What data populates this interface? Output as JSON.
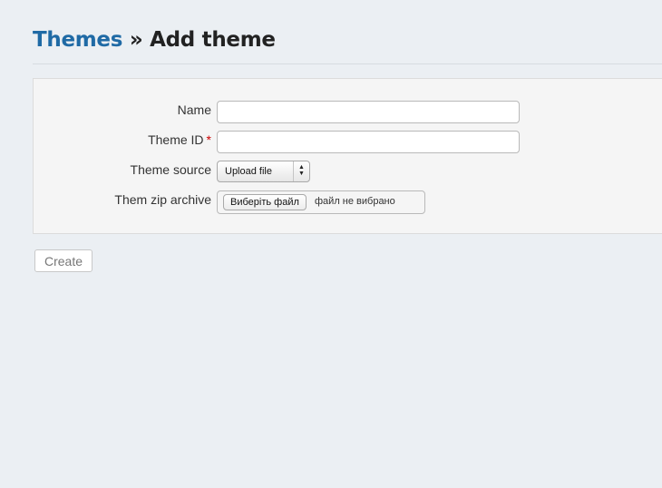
{
  "header": {
    "breadcrumb_link": "Themes",
    "separator": "»",
    "title": "Add theme"
  },
  "form": {
    "name": {
      "label": "Name",
      "value": ""
    },
    "theme_id": {
      "label": "Theme ID",
      "required_mark": "*",
      "value": ""
    },
    "theme_source": {
      "label": "Theme source",
      "selected": "Upload file"
    },
    "zip_archive": {
      "label": "Them zip archive",
      "button_label": "Виберіть файл",
      "status": "файл не вибрано"
    }
  },
  "actions": {
    "create_label": "Create"
  },
  "colors": {
    "background": "#ebeff3",
    "link": "#1f6aa5",
    "required": "#cc0000"
  }
}
